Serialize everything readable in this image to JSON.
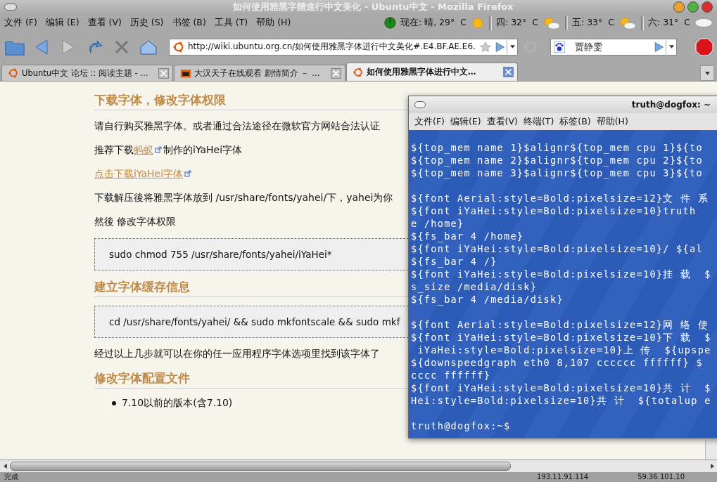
{
  "window": {
    "title": "如何使用雅黑字體進行中文美化 - Ubuntu中文 - Mozilla Firefox"
  },
  "menu": [
    "文件 (F)",
    "编辑 (E)",
    "查看 (V)",
    "历史 (S)",
    "书签 (B)",
    "工具 (T)",
    "帮助 (H)"
  ],
  "weather": [
    {
      "text": "现在: 晴, 29°  C",
      "kind": "sun"
    },
    {
      "text": "四: 32°  C",
      "kind": "partly"
    },
    {
      "text": "五: 33°  C",
      "kind": "partly"
    },
    {
      "text": "六: 31°  C",
      "kind": "cloud"
    }
  ],
  "address": {
    "value": "http://wiki.ubuntu.org.cn/如何使用雅黑字体进行中文美化#.E4.BF.AE.E6."
  },
  "search": {
    "value": "贾静雯"
  },
  "tabs": [
    {
      "label": "Ubuntu中文 论坛 :: 阅读主题 - …",
      "kind": "ubuntu",
      "selected": false
    },
    {
      "label": "大汉天子在线观看 剧情简介  －  …",
      "kind": "tv",
      "selected": false
    },
    {
      "label": "如何使用雅黑字体进行中文…",
      "kind": "ubuntu",
      "selected": true
    }
  ],
  "article": [
    {
      "kind": "heading",
      "text": "下载字体，修改字体权限"
    },
    {
      "kind": "para",
      "text": "请自行购买雅黑字体。或者通过合法途径在微软官方网站合法认证"
    },
    {
      "kind": "para",
      "text": "推荐下载",
      "link": "蚂蚁",
      "after": "制作的iYaHei字体"
    },
    {
      "kind": "link",
      "link": "点击下载iYaHei字体"
    },
    {
      "kind": "para",
      "text": "下载解压後将雅黑字体放到 /usr/share/fonts/yahei/下，yahei为你"
    },
    {
      "kind": "para",
      "text": "然後 修改字体权限"
    },
    {
      "kind": "code",
      "text": "sudo chmod 755 /usr/share/fonts/yahei/iYaHei*"
    },
    {
      "kind": "heading",
      "text": "建立字体缓存信息"
    },
    {
      "kind": "code",
      "text": "cd /usr/share/fonts/yahei/ && sudo mkfontscale && sudo mkf"
    },
    {
      "kind": "para",
      "text": "经过以上几步就可以在你的任一应用程序字体选项里找到该字体了"
    },
    {
      "kind": "heading",
      "text": "修改字体配置文件"
    },
    {
      "kind": "bullet",
      "text": "7.10以前的版本(含7.10)"
    }
  ],
  "terminal": {
    "title": "truth@dogfox: ~",
    "menu": [
      "文件(F)",
      "编辑(E)",
      "查看(V)",
      "终端(T)",
      "标签(B)",
      "帮助(H)"
    ],
    "blocks": [
      [
        "${top_mem name 1}$alignr${top_mem cpu 1}${to",
        "${top_mem name 2}$alignr${top_mem cpu 2}${to",
        "${top_mem name 3}$alignr${top_mem cpu 3}${to"
      ],
      [
        "${font Aerial:style=Bold:pixelsize=12}文 件 系",
        "${font iYaHei:style=Bold:pixelsize=10}truth",
        "e /home}",
        "${fs_bar 4 /home}",
        "${font iYaHei:style=Bold:pixelsize=10}/ ${al",
        "${fs_bar 4 /}",
        "${font iYaHei:style=Bold:pixelsize=10}挂 载  $",
        "s_size /media/disk}",
        "${fs_bar 4 /media/disk}"
      ],
      [
        "${font Aerial:style=Bold:pixelsize=12}网 络 使",
        "${font iYaHei:style=Bold:pixelsize=10}下 载  $",
        " iYaHei:style=Bold:pixelsize=10}上 传  ${upspe",
        "${downspeedgraph eth0 8,107 cccccc ffffff} $",
        "cccc ffffff}",
        "${font iYaHei:style=Bold:pixelsize=10}共 计  $",
        "Hei:style=Bold:pixelsize=10}共 计  ${totalup e"
      ],
      [
        "truth@dogfox:~$"
      ]
    ]
  },
  "status_bar": {
    "text": "完成",
    "ips": [
      "193.11.91.114",
      "59.36.101.10"
    ]
  }
}
